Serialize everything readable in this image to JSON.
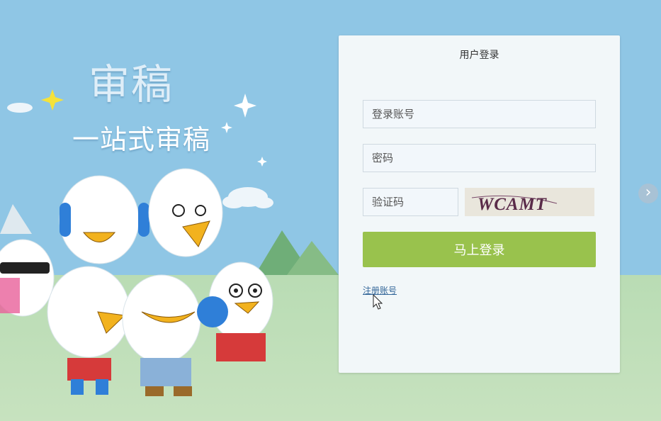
{
  "hero": {
    "title": "审稿",
    "slogan": "一站式审稿"
  },
  "login": {
    "title": "用户登录",
    "account_placeholder": "登录账号",
    "password_placeholder": "密码",
    "captcha_placeholder": "验证码",
    "captcha_text": "WCAMT",
    "submit_label": "马上登录",
    "register_link": "注册账号"
  },
  "carousel": {
    "next_icon": "chevron-right-icon"
  },
  "colors": {
    "sky": "#8fc6e5",
    "panel": "#f2f7f9",
    "accent": "#99c24d",
    "link": "#336699"
  }
}
